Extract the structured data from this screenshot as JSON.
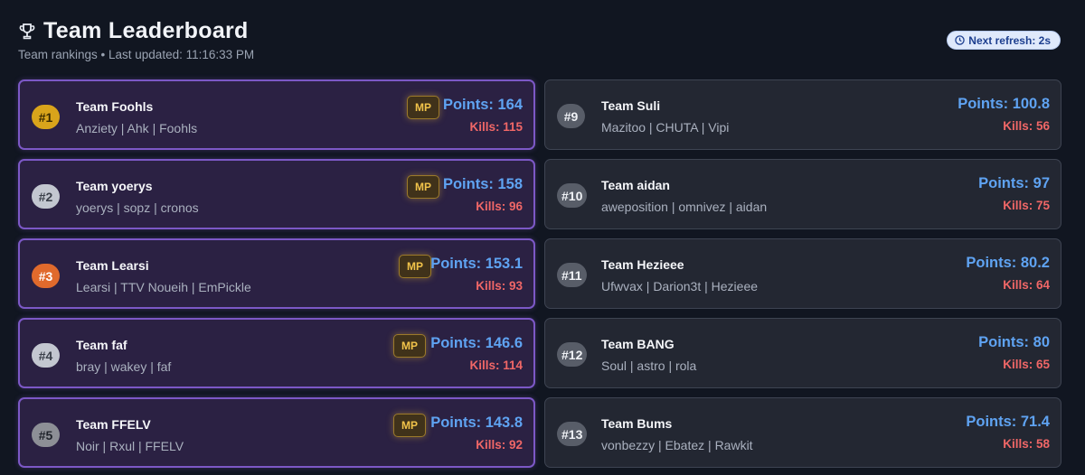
{
  "header": {
    "title": "Team Leaderboard",
    "subtitle": "Team rankings • Last updated: 11:16:33 PM",
    "icon": "trophy-icon",
    "refresh_label": "Next refresh: 2s",
    "refresh_icon": "clock-icon"
  },
  "colors": {
    "background": "#111621",
    "highlight_card": "#2b2143",
    "highlight_border": "#7c58c6",
    "points": "#5fa3f2",
    "kills": "#f06767",
    "mp_badge": "#f1c34a"
  },
  "teams_left": [
    {
      "rank": "#1",
      "name": "Team Foohls",
      "members": "Anziety | Ahk | Foohls",
      "badge": "MP",
      "points": "Points: 164",
      "kills": "Kills: 115"
    },
    {
      "rank": "#2",
      "name": "Team yoerys",
      "members": "yoerys | sopz | cronos",
      "badge": "MP",
      "points": "Points: 158",
      "kills": "Kills: 96"
    },
    {
      "rank": "#3",
      "name": "Team Learsi",
      "members": "Learsi | TTV Noueih | EmPickle",
      "badge": "MP",
      "points": "Points: 153.1",
      "kills": "Kills: 93"
    },
    {
      "rank": "#4",
      "name": "Team faf",
      "members": "bray | wakey | faf",
      "badge": "MP",
      "points": "Points: 146.6",
      "kills": "Kills: 114"
    },
    {
      "rank": "#5",
      "name": "Team FFELV",
      "members": "Noir | Rxul | FFELV",
      "badge": "MP",
      "points": "Points: 143.8",
      "kills": "Kills: 92"
    }
  ],
  "teams_right": [
    {
      "rank": "#9",
      "name": "Team Suli",
      "members": "Mazitoo | CHUTA | Vipi",
      "points": "Points: 100.8",
      "kills": "Kills: 56"
    },
    {
      "rank": "#10",
      "name": "Team aidan",
      "members": "aweposition | omnivez | aidan",
      "points": "Points: 97",
      "kills": "Kills: 75"
    },
    {
      "rank": "#11",
      "name": "Team Hezieee",
      "members": "Ufwvax | Darion3t | Hezieee",
      "points": "Points: 80.2",
      "kills": "Kills: 64"
    },
    {
      "rank": "#12",
      "name": "Team BANG",
      "members": "Soul | astro | rola",
      "points": "Points: 80",
      "kills": "Kills: 65"
    },
    {
      "rank": "#13",
      "name": "Team Bums",
      "members": "vonbezzy | Ebatez | Rawkit",
      "points": "Points: 71.4",
      "kills": "Kills: 58"
    }
  ]
}
